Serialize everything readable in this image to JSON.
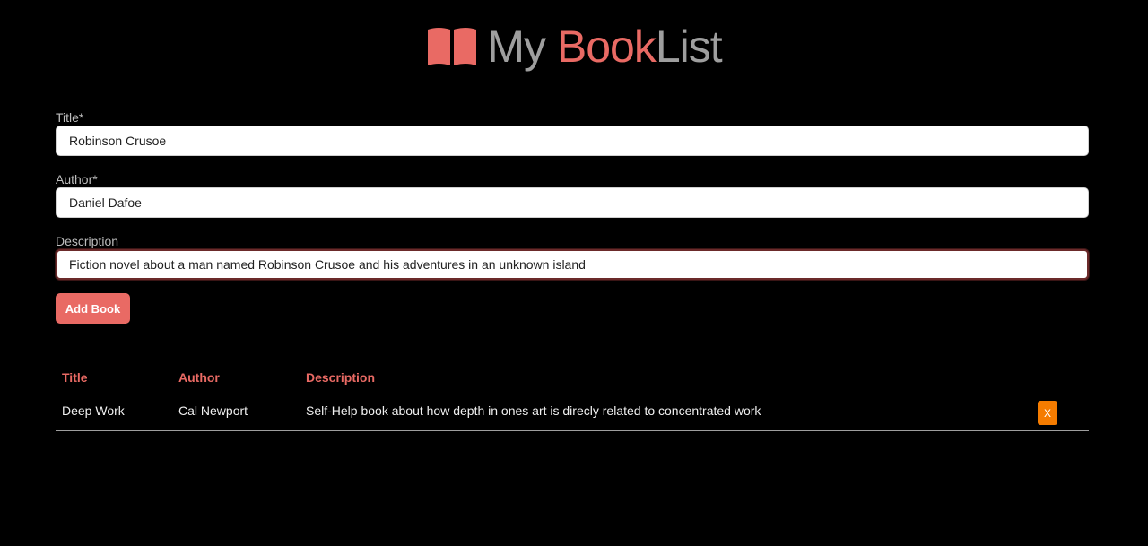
{
  "header": {
    "logo_icon": "open-book-icon",
    "logo_part1": "My ",
    "logo_part2": "Book",
    "logo_part3": "List"
  },
  "form": {
    "title_label": "Title*",
    "title_value": "Robinson Crusoe",
    "author_label": "Author*",
    "author_value": "Daniel Dafoe",
    "description_label": "Description",
    "description_value": "Fiction novel about a man named Robinson Crusoe and his adventures in an unknown island",
    "add_button_label": "Add Book"
  },
  "table": {
    "headers": [
      "Title",
      "Author",
      "Description"
    ],
    "rows": [
      {
        "title": "Deep Work",
        "author": "Cal Newport",
        "description": "Self-Help book about how depth in ones art is direcly related to concentrated work",
        "delete_label": "X"
      }
    ]
  },
  "colors": {
    "accent": "#e96a64",
    "delete": "#f57c00",
    "background": "#000000"
  }
}
